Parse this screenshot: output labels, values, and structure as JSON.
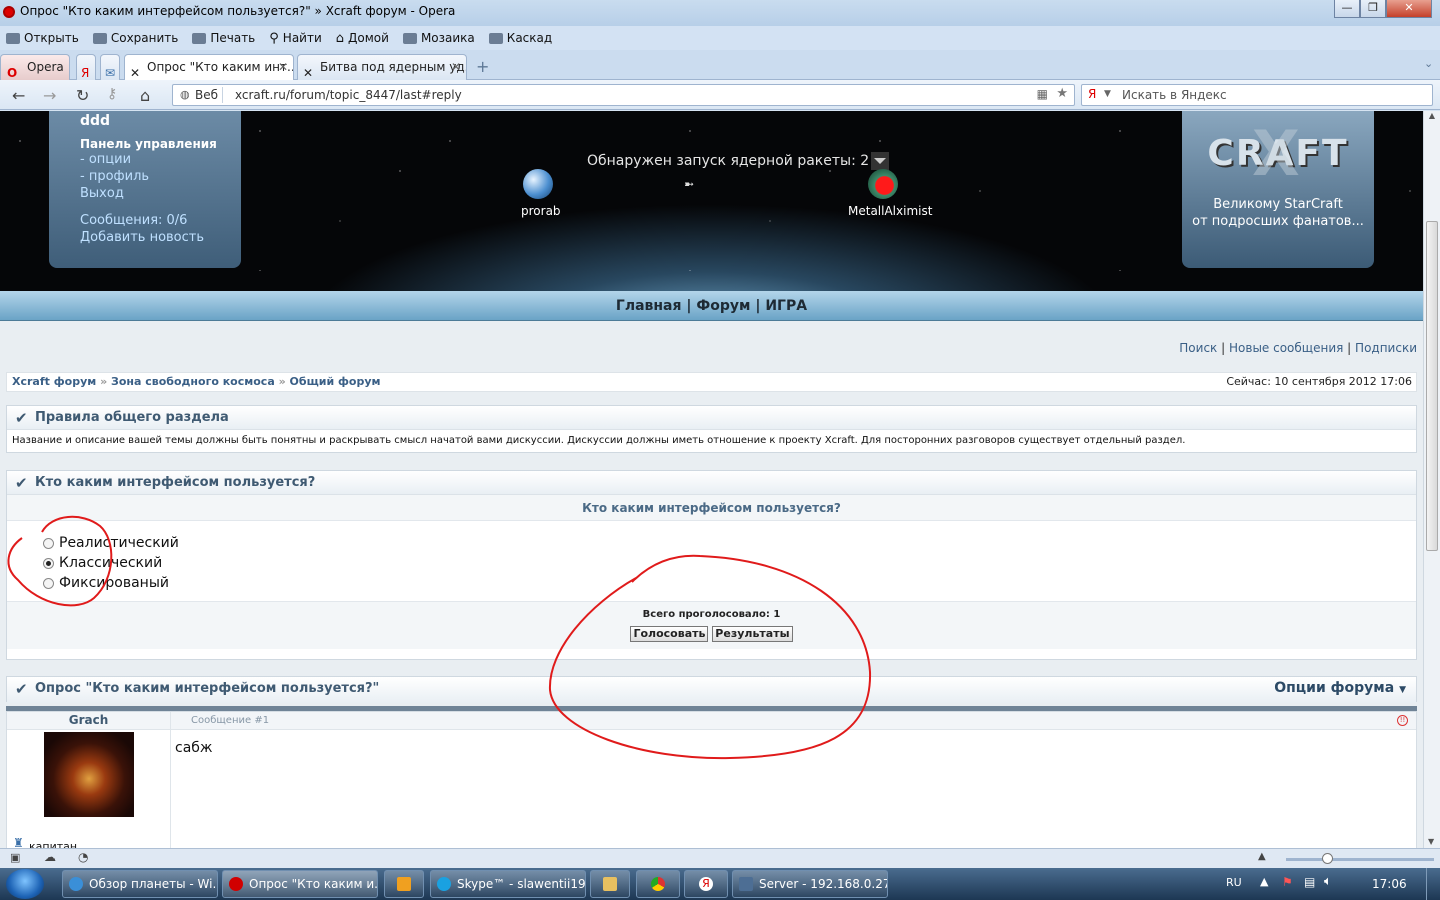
{
  "window": {
    "title": "Опрос \"Кто каким интерфейсом пользуется?\" » Xcraft форум - Opera",
    "buttons": [
      "—",
      "❐",
      "✕"
    ]
  },
  "toolbar": {
    "items": [
      "Открыть",
      "Сохранить",
      "Печать",
      "Найти",
      "Домой",
      "Мозаика",
      "Каскад"
    ]
  },
  "tabs": {
    "opera_menu": "Opera",
    "items": [
      {
        "label": "Опрос \"Кто каким инт...",
        "active": true
      },
      {
        "label": "Битва под ядерным уд...",
        "active": false
      }
    ]
  },
  "address": {
    "scheme_label": "Веб",
    "url": "xcraft.ru/forum/topic_8447/last#reply",
    "search_placeholder": "Искать в Яндекс"
  },
  "banner": {
    "username": "ddd",
    "control_panel": "Панель управления",
    "links": [
      "- опции",
      "- профиль",
      "Выход"
    ],
    "messages": "Сообщения: 0/6",
    "add_news": "Добавить новость",
    "nuke_text": "Обнаружен запуск ядерной ракеты: 2",
    "player_left": "prorab",
    "player_right": "MetallAlximist",
    "logo": "CRAFT",
    "logo_x": "X",
    "slogan_line1": "Великому StarCraft",
    "slogan_line2": "от подросших фанатов..."
  },
  "nav": {
    "items": [
      "Главная",
      "Форум",
      "ИГРА"
    ],
    "sep": "|"
  },
  "toplinks": {
    "items": [
      "Поиск",
      "Новые сообщения",
      "Подписки"
    ],
    "sep": "|"
  },
  "breadcrumb": {
    "items": [
      "Xcraft форум",
      "Зона свободного космоса",
      "Общий форум"
    ],
    "sep": "»",
    "now": "Сейчас: 10 сентября 2012 17:06"
  },
  "rules": {
    "title": "Правила общего раздела",
    "text": "Название и описание вашей темы должны быть понятны и раскрывать смысл начатой вами дискуссии. Дискуссии должны иметь отношение к проекту Xcraft. Для посторонних разговоров существует отдельный раздел."
  },
  "poll": {
    "title": "Кто каким интерфейсом пользуется?",
    "question": "Кто каким интерфейсом пользуется?",
    "options": [
      "Реалистический",
      "Классический",
      "Фиксированый"
    ],
    "selected_index": 1,
    "total": "Всего проголосовало: 1",
    "vote_button": "Голосовать",
    "results_button": "Результаты"
  },
  "topic": {
    "title": "Опрос \"Кто каким интерфейсом пользуется?\"",
    "options_label": "Опции форума"
  },
  "post": {
    "author": "Grach",
    "number": "Сообщение #1",
    "text": "сабж",
    "rank": "капитан"
  },
  "taskbar": {
    "items": [
      {
        "label": "Обзор планеты - Wi...",
        "color": "#3a8fd8"
      },
      {
        "label": "Опрос \"Кто каким и...",
        "color": "#d10000"
      },
      {
        "label": "Skype™ - slawentii19...",
        "color": "#1aa1e1"
      },
      {
        "label": "Server - 192.168.0.27 ...",
        "color": "#4d6e94"
      }
    ],
    "lang": "RU",
    "clock": "17:06"
  },
  "colors": {
    "accent": "#3f5a72",
    "link": "#3a5f86",
    "annotation": "#e01b1b"
  }
}
